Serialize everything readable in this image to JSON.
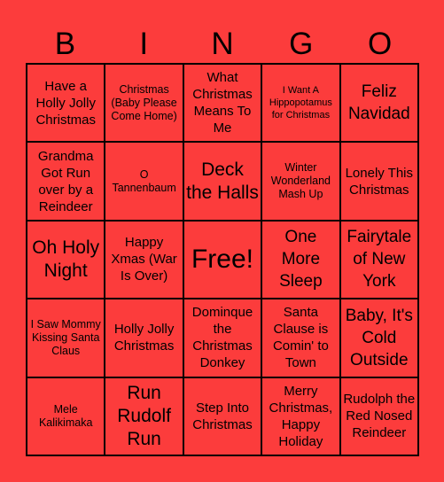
{
  "header": {
    "letters": [
      "B",
      "I",
      "N",
      "G",
      "O"
    ]
  },
  "colors": {
    "background": "#fc3c3c",
    "grid_lines": "#000000",
    "text": "#000000"
  },
  "cells": [
    [
      "Have a Holly Jolly Christmas",
      "Christmas (Baby Please Come Home)",
      "What Christmas Means To Me",
      "I Want A Hippopotamus for Christmas",
      "Feliz Navidad"
    ],
    [
      "Grandma Got Run over by a Reindeer",
      "O Tannenbaum",
      "Deck the Halls",
      "Winter Wonderland Mash Up",
      "Lonely This Christmas"
    ],
    [
      "Oh Holy Night",
      "Happy Xmas (War Is Over)",
      "Free!",
      "One More Sleep",
      "Fairytale of New York"
    ],
    [
      "I Saw Mommy Kissing Santa Claus",
      "Holly Jolly Christmas",
      "Dominque the Christmas Donkey",
      "Santa Clause is Comin' to Town",
      "Baby, It's Cold Outside"
    ],
    [
      "Mele Kalikimaka",
      "Run Rudolf Run",
      "Step Into Christmas",
      "Merry Christmas, Happy Holiday",
      "Rudolph the Red Nosed Reindeer"
    ]
  ]
}
